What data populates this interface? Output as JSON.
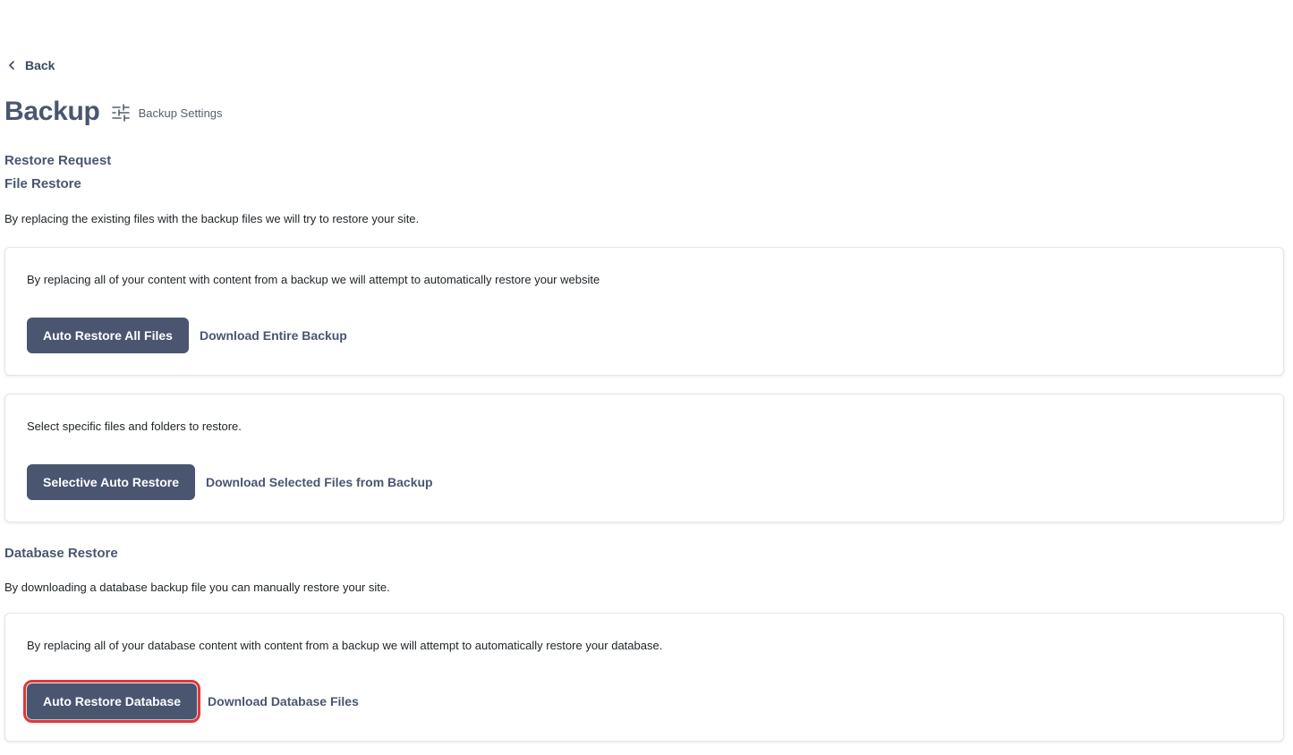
{
  "nav": {
    "back_label": "Back"
  },
  "header": {
    "title": "Backup",
    "settings_label": "Backup Settings"
  },
  "restore_request": {
    "heading": "Restore Request"
  },
  "file_restore": {
    "heading": "File Restore",
    "description": "By replacing the existing files with the backup files we will try to restore your site.",
    "cards": [
      {
        "text": "By replacing all of your content with content from a backup we will attempt to automatically restore your website",
        "primary_label": "Auto Restore All Files",
        "link_label": "Download Entire Backup"
      },
      {
        "text": "Select specific files and folders to restore.",
        "primary_label": "Selective Auto Restore",
        "link_label": "Download Selected Files from Backup"
      }
    ]
  },
  "database_restore": {
    "heading": "Database Restore",
    "description": "By downloading a database backup file you can manually restore your site.",
    "card": {
      "text": "By replacing all of your database content with content from a backup we will attempt to automatically restore your database.",
      "primary_label": "Auto Restore Database",
      "link_label": "Download Database Files"
    }
  },
  "colors": {
    "accent": "#4a5670",
    "highlight": "#e0383b"
  },
  "icons": {
    "back": "chevron-left-icon",
    "settings": "sliders-icon"
  }
}
